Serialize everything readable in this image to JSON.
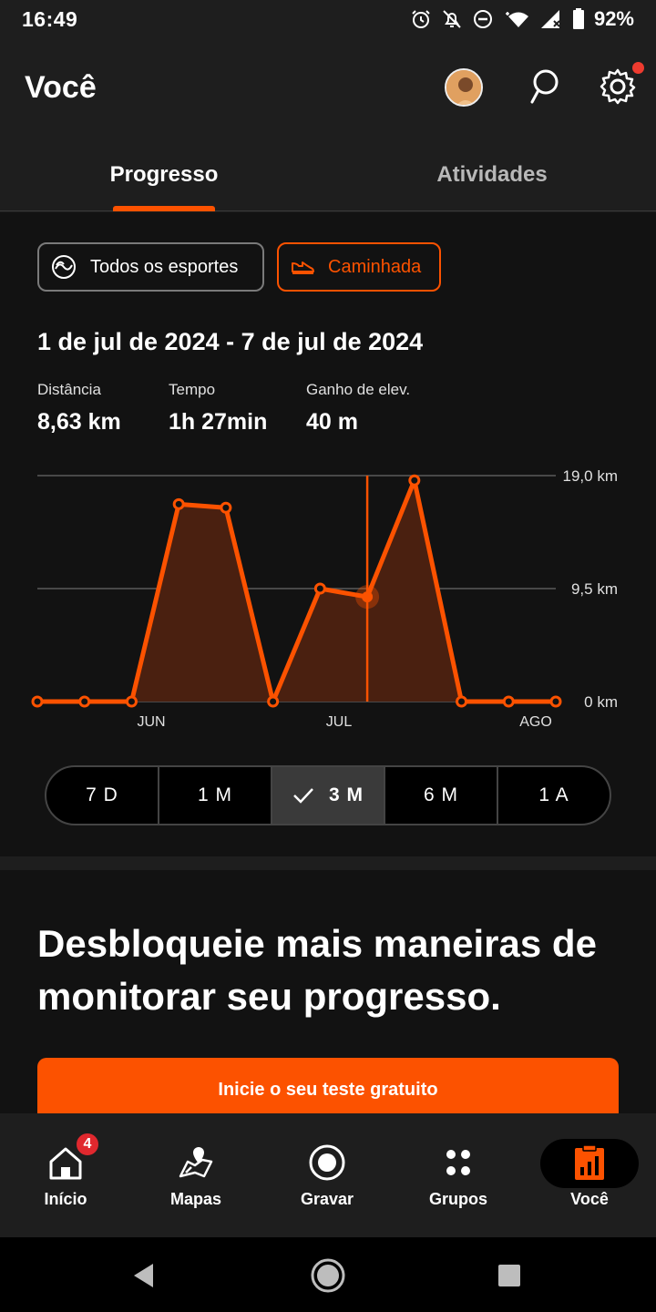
{
  "status_bar": {
    "time": "16:49",
    "battery_pct": "92%"
  },
  "header": {
    "title": "Você"
  },
  "tabs": [
    {
      "label": "Progresso",
      "active": true
    },
    {
      "label": "Atividades",
      "active": false
    }
  ],
  "filters": {
    "all_sports": "Todos os esportes",
    "selected_sport": "Caminhada"
  },
  "summary": {
    "date_range": "1 de jul de 2024 - 7 de jul de 2024",
    "stats": [
      {
        "label": "Distância",
        "value": "8,63 km"
      },
      {
        "label": "Tempo",
        "value": "1h 27min"
      },
      {
        "label": "Ganho de elev.",
        "value": "40 m"
      }
    ]
  },
  "chart_data": {
    "type": "area",
    "title": "",
    "xlabel": "",
    "ylabel": "",
    "x_tick_labels": [
      "JUN",
      "JUL",
      "AGO"
    ],
    "y_tick_labels": [
      "19,0 km",
      "9,5 km",
      "0 km"
    ],
    "ylim": [
      0,
      19.0
    ],
    "series": [
      {
        "values": [
          0,
          0,
          0,
          16.6,
          16.3,
          0,
          9.5,
          8.8,
          18.6,
          0,
          0,
          0
        ]
      }
    ],
    "selected_index": 7,
    "color": "#fc5200",
    "fill_color": "#4a2010",
    "grid": true
  },
  "range_selector": {
    "options": [
      "7 D",
      "1 M",
      "3 M",
      "6 M",
      "1 A"
    ],
    "selected": "3 M"
  },
  "upsell": {
    "headline": "Desbloqueie mais maneiras de monitorar seu progresso.",
    "cta": "Inicie o seu teste gratuito"
  },
  "bottom_nav": {
    "items": [
      {
        "label": "Início",
        "badge": "4"
      },
      {
        "label": "Mapas"
      },
      {
        "label": "Gravar"
      },
      {
        "label": "Grupos"
      },
      {
        "label": "Você",
        "active": true
      }
    ]
  },
  "colors": {
    "accent": "#fc5200",
    "background": "#121212",
    "surface": "#1e1e1e"
  }
}
